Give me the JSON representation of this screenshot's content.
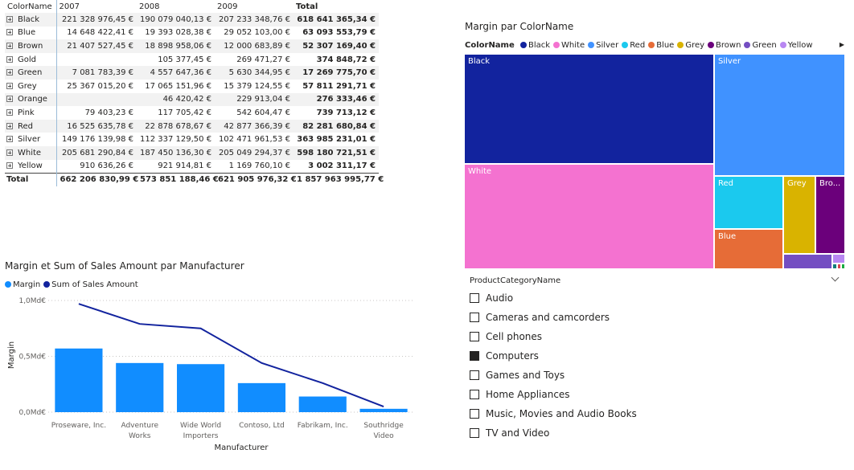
{
  "matrix": {
    "headers": [
      "ColorName",
      "2007",
      "2008",
      "2009",
      "Total"
    ],
    "rows": [
      {
        "name": "Black",
        "v2007": "221 328 976,45 €",
        "v2008": "190 079 040,13 €",
        "v2009": "207 233 348,76 €",
        "total": "618 641 365,34 €"
      },
      {
        "name": "Blue",
        "v2007": "14 648 422,41 €",
        "v2008": "19 393 028,38 €",
        "v2009": "29 052 103,00 €",
        "total": "63 093 553,79 €"
      },
      {
        "name": "Brown",
        "v2007": "21 407 527,45 €",
        "v2008": "18 898 958,06 €",
        "v2009": "12 000 683,89 €",
        "total": "52 307 169,40 €"
      },
      {
        "name": "Gold",
        "v2007": "",
        "v2008": "105 377,45 €",
        "v2009": "269 471,27 €",
        "total": "374 848,72 €"
      },
      {
        "name": "Green",
        "v2007": "7 081 783,39 €",
        "v2008": "4 557 647,36 €",
        "v2009": "5 630 344,95 €",
        "total": "17 269 775,70 €"
      },
      {
        "name": "Grey",
        "v2007": "25 367 015,20 €",
        "v2008": "17 065 151,96 €",
        "v2009": "15 379 124,55 €",
        "total": "57 811 291,71 €"
      },
      {
        "name": "Orange",
        "v2007": "",
        "v2008": "46 420,42 €",
        "v2009": "229 913,04 €",
        "total": "276 333,46 €"
      },
      {
        "name": "Pink",
        "v2007": "79 403,23 €",
        "v2008": "117 705,42 €",
        "v2009": "542 604,47 €",
        "total": "739 713,12 €"
      },
      {
        "name": "Red",
        "v2007": "16 525 635,78 €",
        "v2008": "22 878 678,67 €",
        "v2009": "42 877 366,39 €",
        "total": "82 281 680,84 €"
      },
      {
        "name": "Silver",
        "v2007": "149 176 139,98 €",
        "v2008": "112 337 129,50 €",
        "v2009": "102 471 961,53 €",
        "total": "363 985 231,01 €"
      },
      {
        "name": "White",
        "v2007": "205 681 290,84 €",
        "v2008": "187 450 136,30 €",
        "v2009": "205 049 294,37 €",
        "total": "598 180 721,51 €"
      },
      {
        "name": "Yellow",
        "v2007": "910 636,26 €",
        "v2008": "921 914,81 €",
        "v2009": "1 169 760,10 €",
        "total": "3 002 311,17 €"
      }
    ],
    "total_row": {
      "name": "Total",
      "v2007": "662 206 830,99 €",
      "v2008": "573 851 188,46 €",
      "v2009": "621 905 976,32 €",
      "total": "1 857 963 995,77 €"
    }
  },
  "treemap": {
    "title": "Margin par ColorName",
    "legend_title": "ColorName",
    "legend": [
      {
        "name": "Black",
        "color": "#12239e"
      },
      {
        "name": "White",
        "color": "#f472d0"
      },
      {
        "name": "Silver",
        "color": "#4092ff"
      },
      {
        "name": "Red",
        "color": "#1bc9ee"
      },
      {
        "name": "Blue",
        "color": "#e66c37"
      },
      {
        "name": "Grey",
        "color": "#d9b300"
      },
      {
        "name": "Brown",
        "color": "#6b007b"
      },
      {
        "name": "Green",
        "color": "#744ec2"
      },
      {
        "name": "Yellow",
        "color": "#b887f2"
      }
    ],
    "tiles": [
      {
        "name": "Black",
        "label": "Black",
        "color": "#12239e"
      },
      {
        "name": "White",
        "label": "White",
        "color": "#f472d0"
      },
      {
        "name": "Silver",
        "label": "Silver",
        "color": "#4092ff"
      },
      {
        "name": "Red",
        "label": "Red",
        "color": "#1bc9ee"
      },
      {
        "name": "Blue",
        "label": "Blue",
        "color": "#e66c37"
      },
      {
        "name": "Grey",
        "label": "Grey",
        "color": "#d9b300"
      },
      {
        "name": "Brown",
        "label": "Bro...",
        "color": "#6b007b"
      },
      {
        "name": "Green",
        "label": "",
        "color": "#744ec2"
      },
      {
        "name": "Yellow",
        "label": "",
        "color": "#b887f2"
      },
      {
        "name": "Pink",
        "label": "",
        "color": "#107c7c"
      },
      {
        "name": "Gold",
        "label": "",
        "color": "#d64550"
      },
      {
        "name": "Orange",
        "label": "",
        "color": "#1aab40"
      }
    ]
  },
  "chart_data": {
    "type": "bar",
    "title": "Margin et Sum of Sales Amount par Manufacturer",
    "xlabel": "Manufacturer",
    "ylabel": "Margin",
    "ylim": [
      0,
      1.0
    ],
    "yticks": [
      {
        "value": 0,
        "label": "0,0Md€"
      },
      {
        "value": 0.5,
        "label": "0,5Md€"
      },
      {
        "value": 1.0,
        "label": "1,0Md€"
      }
    ],
    "categories": [
      [
        "Proseware, Inc."
      ],
      [
        "Adventure",
        "Works"
      ],
      [
        "Wide World",
        "Importers"
      ],
      [
        "Contoso, Ltd"
      ],
      [
        "Fabrikam, Inc."
      ],
      [
        "Southridge",
        "Video"
      ]
    ],
    "series": [
      {
        "name": "Margin",
        "kind": "bar",
        "color": "#118dff",
        "values": [
          0.57,
          0.44,
          0.43,
          0.26,
          0.14,
          0.03
        ]
      },
      {
        "name": "Sum of Sales Amount",
        "kind": "line",
        "color": "#12239e",
        "values": [
          0.97,
          0.79,
          0.75,
          0.44,
          0.26,
          0.05
        ]
      }
    ]
  },
  "slicer": {
    "title": "ProductCategoryName",
    "items": [
      {
        "label": "Audio",
        "checked": false
      },
      {
        "label": "Cameras and camcorders",
        "checked": false
      },
      {
        "label": "Cell phones",
        "checked": false
      },
      {
        "label": "Computers",
        "checked": true
      },
      {
        "label": "Games and Toys",
        "checked": false
      },
      {
        "label": "Home Appliances",
        "checked": false
      },
      {
        "label": "Music, Movies and Audio Books",
        "checked": false
      },
      {
        "label": "TV and Video",
        "checked": false
      }
    ]
  }
}
